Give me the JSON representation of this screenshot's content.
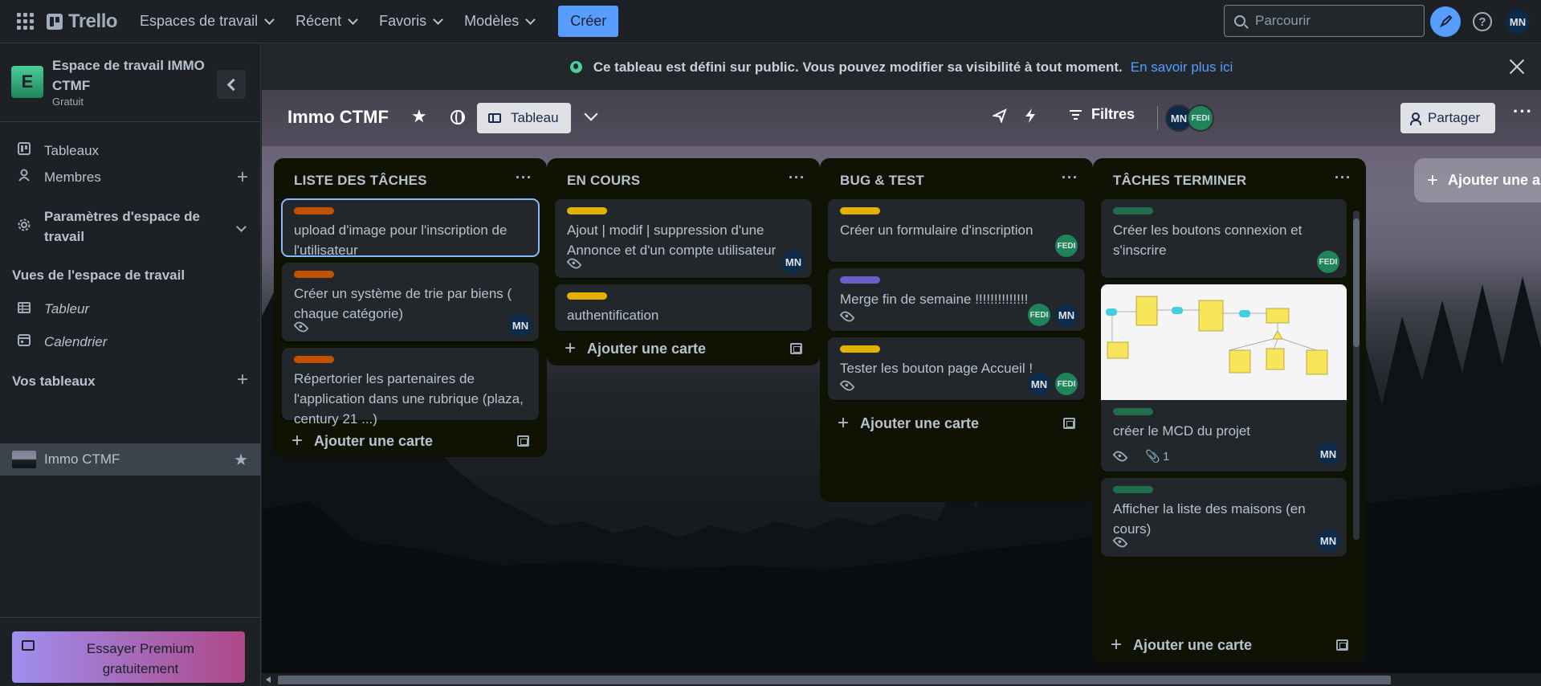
{
  "topnav": {
    "brand": "Trello",
    "menus": [
      "Espaces de travail",
      "Récent",
      "Favoris",
      "Modèles"
    ],
    "create_label": "Créer",
    "search_placeholder": "Parcourir",
    "user_initials": "MN",
    "help_glyph": "?"
  },
  "sidebar": {
    "workspace_initial": "E",
    "workspace_name": "Espace de travail IMMO CTMF",
    "workspace_plan": "Gratuit",
    "items": [
      {
        "label": "Tableaux",
        "icon": "board-icon"
      },
      {
        "label": "Membres",
        "icon": "person-icon"
      },
      {
        "label": "Paramètres d'espace de travail",
        "icon": "gear-icon"
      }
    ],
    "views_heading": "Vues de l'espace de travail",
    "views": [
      {
        "label": "Tableur",
        "icon": "table-icon"
      },
      {
        "label": "Calendrier",
        "icon": "calendar-icon"
      }
    ],
    "boards_heading": "Vos tableaux",
    "boards": [
      {
        "label": "Immo CTMF",
        "starred": true
      }
    ],
    "premium_label": "Essayer Premium gratuitement"
  },
  "banner": {
    "message": "Ce tableau est défini sur public. Vous pouvez modifier sa visibilité à tout moment.",
    "link": "En savoir plus ici"
  },
  "board": {
    "title": "Immo CTMF",
    "view_label": "Tableau",
    "filters_label": "Filtres",
    "share_label": "Partager",
    "members": [
      "MN",
      "FEDI"
    ],
    "add_list_label": "Ajouter une autre liste",
    "add_card_label": "Ajouter une carte",
    "lists": [
      {
        "title": "LISTE DES TÂCHES",
        "cards": [
          {
            "label_color": "#c25100",
            "title": "upload d'image pour l'inscription de l'utilisateur",
            "selected": true
          },
          {
            "label_color": "#c25100",
            "title": "Créer un système de trie par biens ( chaque catégorie)",
            "watched": true,
            "members": [
              "MN"
            ]
          },
          {
            "label_color": "#c25100",
            "title": "Répertorier les partenaires de l'application dans une rubrique (plaza, century 21 ...)"
          }
        ]
      },
      {
        "title": "EN COURS",
        "cards": [
          {
            "label_color": "#e2b203",
            "title": "Ajout | modif | suppression d'une Annonce et d'un compte utilisateur",
            "watched": true,
            "members": [
              "MN"
            ]
          },
          {
            "label_color": "#e2b203",
            "title": "authentification"
          }
        ]
      },
      {
        "title": "BUG & TEST",
        "cards": [
          {
            "label_color": "#e2b203",
            "title": "Créer un formulaire d'inscription",
            "members": [
              "FEDI"
            ]
          },
          {
            "label_color": "#6e5dc6",
            "title": "Merge fin de semaine !!!!!!!!!!!!!!",
            "watched": true,
            "members": [
              "FEDI",
              "MN"
            ]
          },
          {
            "label_color": "#e2b203",
            "title": "Tester les bouton page Accueil !",
            "watched": true,
            "members": [
              "MN",
              "FEDI"
            ]
          }
        ]
      },
      {
        "title": "TÂCHES TERMINER",
        "cards": [
          {
            "label_color": "#216e4e",
            "title": "Créer les boutons connexion et s'inscrire",
            "members": [
              "FEDI"
            ]
          },
          {
            "label_color": "#216e4e",
            "title": "créer le MCD du projet",
            "watched": true,
            "attachments": "1",
            "members": [
              "MN"
            ],
            "cover": "mcd-diagram"
          },
          {
            "label_color": "#216e4e",
            "title": "Afficher la liste des maisons (en cours)",
            "watched": true,
            "members": [
              "MN"
            ]
          }
        ]
      }
    ]
  }
}
